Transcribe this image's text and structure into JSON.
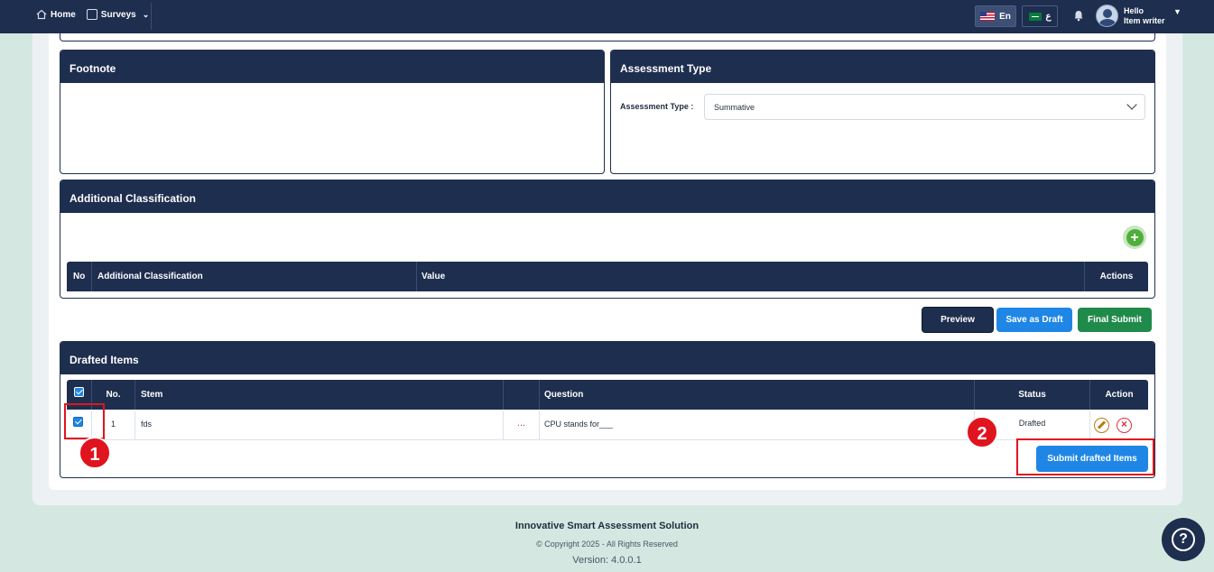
{
  "nav": {
    "home_label": "Home",
    "surveys_label": "Surveys",
    "lang_en_label": "En",
    "lang_ar_label": "ع",
    "greeting": "Hello",
    "user_name": "Item writer"
  },
  "footnote_panel": {
    "title": "Footnote"
  },
  "assessment_panel": {
    "title": "Assessment Type",
    "field_label": "Assessment Type :",
    "selected_value": "Summative"
  },
  "classification_panel": {
    "title": "Additional Classification",
    "columns": [
      "No",
      "Additional Classification",
      "Value",
      "Actions"
    ]
  },
  "actions": {
    "preview_label": "Preview",
    "save_draft_label": "Save as Draft",
    "final_submit_label": "Final Submit"
  },
  "drafted_panel": {
    "title": "Drafted Items",
    "columns": {
      "no": "No.",
      "stem": "Stem",
      "question": "Question",
      "status": "Status",
      "action": "Action"
    },
    "rows": [
      {
        "no": "1",
        "stem": "fds",
        "more": "...",
        "question": "CPU stands for___",
        "status": "Drafted"
      }
    ],
    "submit_label": "Submit drafted Items"
  },
  "markers": [
    "1",
    "2"
  ],
  "footer": {
    "title": "Innovative Smart Assessment Solution",
    "copyright": "© Copyright 2025 - All Rights Reserved",
    "version": "Version: 4.0.0.1"
  },
  "colors": {
    "navy": "#1e2e4f",
    "primary": "#1f86e6",
    "success": "#1f8a4a",
    "highlight": "#e0141e"
  }
}
